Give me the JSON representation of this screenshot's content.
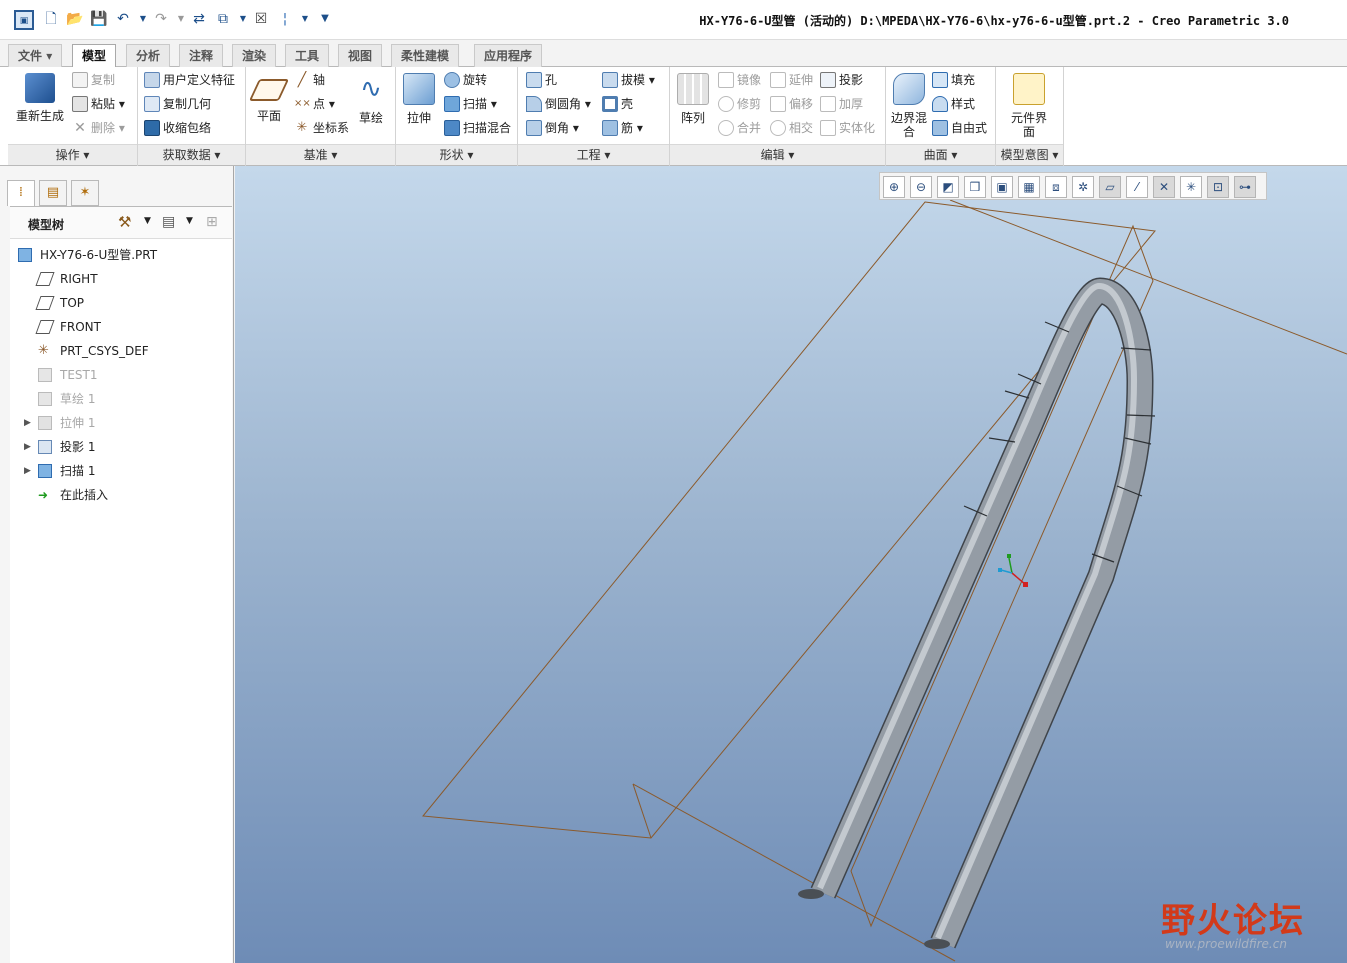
{
  "window": {
    "title": "HX-Y76-6-U型管 (活动的) D:\\MPEDA\\HX-Y76-6\\hx-y76-6-u型管.prt.2 - Creo Parametric 3.0"
  },
  "quick_access": {
    "icons": [
      "app-icon",
      "new-icon",
      "open-icon",
      "save-icon",
      "undo-icon",
      "undo-dropdown-icon",
      "redo-icon",
      "redo-dropdown-icon",
      "regenerate-icon",
      "windows-icon",
      "windows-dropdown-icon",
      "close-window-icon",
      "separator-icon",
      "dropdown-icon",
      "customize-icon"
    ]
  },
  "tabs": [
    "文件",
    "模型",
    "分析",
    "注释",
    "渲染",
    "工具",
    "视图",
    "柔性建模",
    "应用程序"
  ],
  "ribbon": {
    "groups": {
      "operations": {
        "label": "操作",
        "regen": "重新生成",
        "copy": "复制",
        "paste": "粘贴",
        "delete": "删除"
      },
      "get_data": {
        "label": "获取数据",
        "udf": "用户定义特征",
        "copy_geom": "复制几何",
        "shrinkwrap": "收缩包络"
      },
      "datum": {
        "label": "基准",
        "plane": "平面",
        "axis": "轴",
        "point": "点",
        "csys": "坐标系",
        "sketch": "草绘"
      },
      "shapes": {
        "label": "形状",
        "extrude": "拉伸",
        "revolve": "旋转",
        "sweep": "扫描",
        "swept_blend": "扫描混合"
      },
      "engineering": {
        "label": "工程",
        "hole": "孔",
        "round": "倒圆角",
        "chamfer": "倒角",
        "draft": "拔模",
        "shell": "壳",
        "rib": "筋"
      },
      "editing": {
        "label": "编辑",
        "pattern": "阵列",
        "mirror": "镜像",
        "trim": "修剪",
        "merge": "合并",
        "extend": "延伸",
        "offset": "偏移",
        "intersect": "相交",
        "project": "投影",
        "thicken": "加厚",
        "solidify": "实体化"
      },
      "surfaces": {
        "label": "曲面",
        "boundary_blend": "边界混合",
        "fill": "填充",
        "style": "样式",
        "freestyle": "自由式"
      },
      "intent": {
        "label": "模型意图",
        "component_interface": "元件界面"
      }
    }
  },
  "model_tree": {
    "header": "模型树",
    "items": [
      {
        "label": "HX-Y76-6-U型管.PRT",
        "icon": "part-icon",
        "dim": false,
        "expandable": false
      },
      {
        "label": "RIGHT",
        "icon": "datum-plane-icon",
        "dim": false,
        "expandable": false
      },
      {
        "label": "TOP",
        "icon": "datum-plane-icon",
        "dim": false,
        "expandable": false
      },
      {
        "label": "FRONT",
        "icon": "datum-plane-icon",
        "dim": false,
        "expandable": false
      },
      {
        "label": "PRT_CSYS_DEF",
        "icon": "csys-icon",
        "dim": false,
        "expandable": false
      },
      {
        "label": "TEST1",
        "icon": "sketch-icon",
        "dim": true,
        "expandable": false
      },
      {
        "label": "草绘 1",
        "icon": "sketch-icon",
        "dim": true,
        "expandable": false
      },
      {
        "label": "拉伸 1",
        "icon": "extrude-icon",
        "dim": true,
        "expandable": true
      },
      {
        "label": "投影 1",
        "icon": "projection-icon",
        "dim": false,
        "expandable": true
      },
      {
        "label": "扫描 1",
        "icon": "sweep-icon",
        "dim": false,
        "expandable": true
      },
      {
        "label": "在此插入",
        "icon": "insert-arrow-icon",
        "dim": false,
        "expandable": false
      }
    ]
  },
  "view_toolbar": {
    "icons": [
      "zoom-in-icon",
      "zoom-out-icon",
      "refit-icon",
      "display-style-icon",
      "saved-orientations-icon",
      "view-manager-icon",
      "perspective-icon",
      "datum-display-icon",
      "plane-display-icon",
      "axis-display-icon",
      "point-display-icon",
      "csys-display-icon",
      "annotation-display-icon",
      "spin-center-icon"
    ]
  },
  "watermark": {
    "text": "野火论坛",
    "url": "www.proewildfire.cn"
  },
  "colors": {
    "viewport_top": "#c4d8eb",
    "viewport_bottom": "#6e8cb6",
    "datum_plane": "#8b5a2b",
    "pipe": "#9aa2ab"
  }
}
